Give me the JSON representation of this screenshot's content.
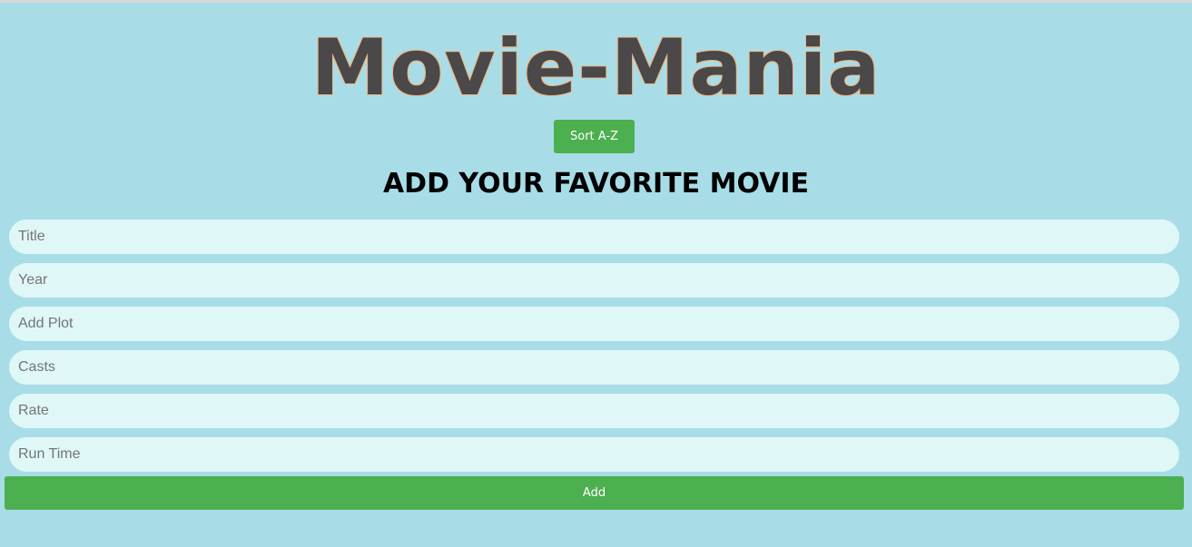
{
  "app": {
    "title": "Movie-Mania"
  },
  "toolbar": {
    "sort_label": "Sort A-Z"
  },
  "form": {
    "heading": "ADD YOUR FAVORITE MOVIE",
    "fields": [
      {
        "placeholder": "Title",
        "value": ""
      },
      {
        "placeholder": "Year",
        "value": ""
      },
      {
        "placeholder": "Add Plot",
        "value": ""
      },
      {
        "placeholder": "Casts",
        "value": ""
      },
      {
        "placeholder": "Rate",
        "value": ""
      },
      {
        "placeholder": "Run Time",
        "value": ""
      }
    ],
    "submit_label": "Add"
  },
  "colors": {
    "background": "#a8dde8",
    "accent": "#4caf50",
    "field_background": "#dff7f7",
    "title_text": "#4a4848",
    "title_outline": "#e9b98b"
  }
}
